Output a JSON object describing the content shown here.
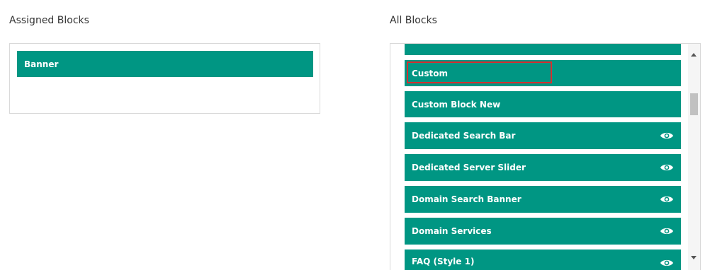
{
  "assigned": {
    "heading": "Assigned Blocks",
    "blocks": [
      "Banner"
    ]
  },
  "all": {
    "heading": "All Blocks",
    "blocks": [
      {
        "label": "",
        "preview": false
      },
      {
        "label": "Custom",
        "preview": false,
        "selected": true
      },
      {
        "label": "Custom Block New",
        "preview": false
      },
      {
        "label": "Dedicated Search Bar",
        "preview": true
      },
      {
        "label": "Dedicated Server Slider",
        "preview": true
      },
      {
        "label": "Domain Search Banner",
        "preview": true
      },
      {
        "label": "Domain Services",
        "preview": true
      },
      {
        "label": "FAQ (Style 1)",
        "preview": true
      }
    ]
  },
  "colors": {
    "block_bg": "#009683",
    "selection_outline": "#d32f2f"
  },
  "icons": {
    "preview": "eye-icon"
  }
}
